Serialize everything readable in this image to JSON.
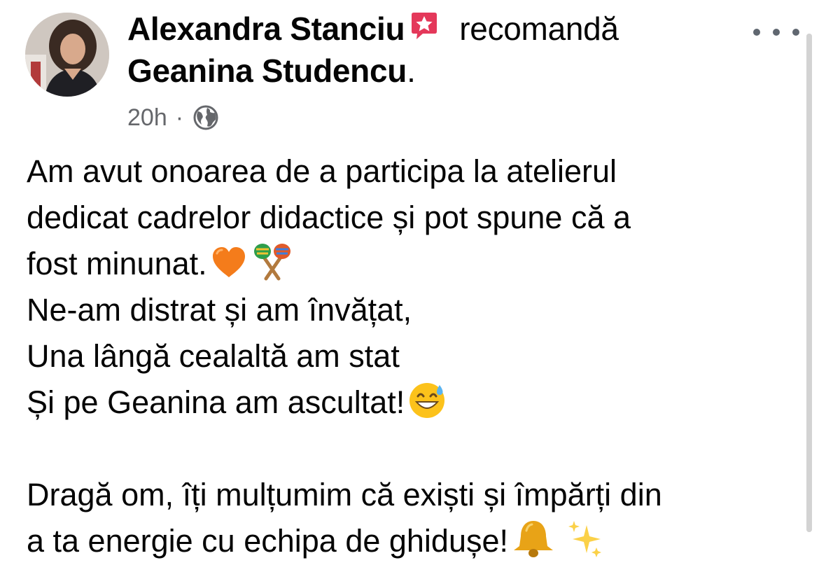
{
  "post": {
    "author": "Alexandra Stanciu",
    "action": "recomandă",
    "recommended_page": "Geanina Studencu",
    "recommended_suffix": ".",
    "timestamp": "20h",
    "separator": "·",
    "audience_icon": "globe-icon",
    "badge_icon": "recommendation-star-icon",
    "more_icon": "more-options-icon",
    "lines": [
      "Am avut onoarea de a participa la atelierul",
      "dedicat cadrelor didactice și pot spune că a",
      "fost minunat.",
      "Ne-am distrat și am învățat,",
      "Una lângă cealaltă am stat",
      "Și pe Geanina am ascultat!",
      "Dragă om, îți mulțumim că exiști și împărți din",
      "a ta energie cu echipa de ghidușe!"
    ],
    "emojis": [
      "orange-heart-emoji",
      "maracas-emoji",
      "grinning-sweat-emoji",
      "bell-emoji",
      "sparkles-emoji"
    ]
  },
  "colors": {
    "text": "#050505",
    "secondary": "#65676b",
    "badge": "#e4385a"
  }
}
